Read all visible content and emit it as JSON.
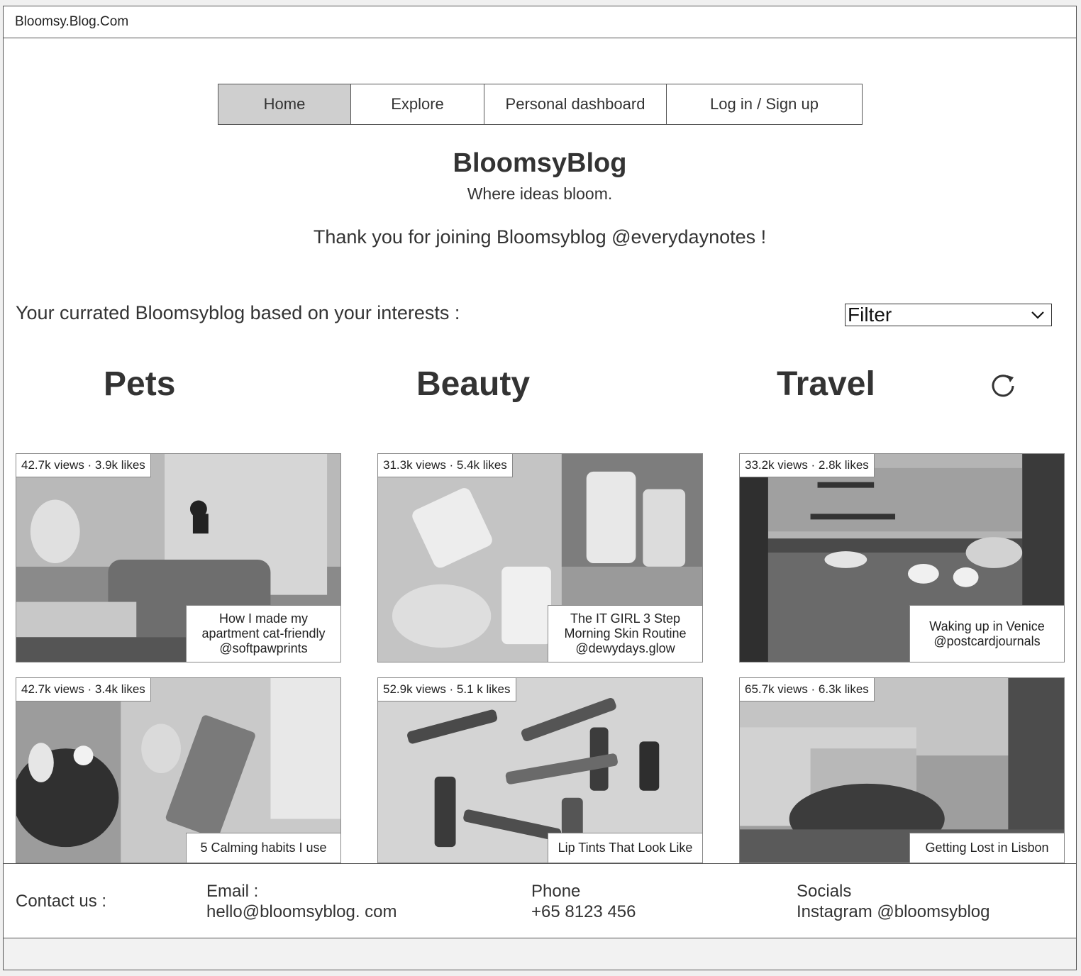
{
  "browser": {
    "url": "Bloomsy.Blog.Com"
  },
  "nav": {
    "items": [
      {
        "label": "Home",
        "active": true
      },
      {
        "label": "Explore",
        "active": false
      },
      {
        "label": "Personal dashboard",
        "active": false
      },
      {
        "label": "Log in / Sign up",
        "active": false
      }
    ]
  },
  "brand": {
    "title": "BloomsyBlog",
    "tagline": "Where ideas bloom."
  },
  "welcome": "Thank you for joining Bloomsyblog @everydaynotes !",
  "curated": {
    "heading": "Your currated Bloomsyblog based on your interests :",
    "filter_label": "Filter"
  },
  "categories": [
    "Pets",
    "Beauty",
    "Travel"
  ],
  "posts": [
    {
      "stats": "42.7k views ·  3.9k likes",
      "title": "How I made my apartment cat-friendly",
      "author": "@softpawprints"
    },
    {
      "stats": "31.3k views ·  5.4k likes",
      "title": "The IT GIRL 3 Step Morning Skin Routine",
      "author": "@dewydays.glow"
    },
    {
      "stats": "33.2k views · 2.8k likes",
      "title": "Waking up in Venice",
      "author": "@postcardjournals"
    },
    {
      "stats": "42.7k views ·  3.4k likes",
      "title": "5 Calming habits I use",
      "author": ""
    },
    {
      "stats": "52.9k views ·  5.1 k likes",
      "title": "Lip Tints That Look Like",
      "author": ""
    },
    {
      "stats": "65.7k views · 6.3k likes",
      "title": "Getting Lost in Lisbon",
      "author": ""
    }
  ],
  "footer": {
    "contact_label": "Contact us :",
    "email_label": "Email :",
    "email_value": "hello@bloomsyblog. com",
    "phone_label": "Phone",
    "phone_value": "+65 8123 456",
    "socials_label": "Socials",
    "socials_value": "Instagram @bloomsyblog"
  },
  "icons": {
    "refresh": "refresh-icon",
    "filter_chevron": "chevron-down-icon"
  }
}
